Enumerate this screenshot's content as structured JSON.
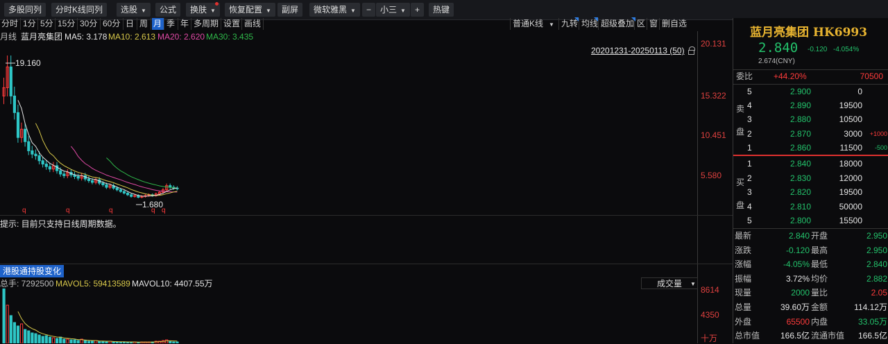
{
  "toolbar": {
    "items": [
      {
        "label": "多股同列",
        "dropdown": false
      },
      {
        "label": "分时K线同列",
        "dropdown": false
      },
      {
        "label": "选股",
        "dropdown": true
      },
      {
        "label": "公式",
        "dropdown": false
      },
      {
        "label": "换肤",
        "dropdown": true
      },
      {
        "label": "恢复配置",
        "dropdown": true
      },
      {
        "label": "副屏",
        "dropdown": false
      },
      {
        "label": "微软雅黑",
        "dropdown": true
      },
      {
        "label": "−",
        "dropdown": false
      },
      {
        "label": "小三",
        "dropdown": true
      },
      {
        "label": "+",
        "dropdown": false
      },
      {
        "label": "热键",
        "dropdown": false
      }
    ]
  },
  "periods": [
    "分时",
    "1分",
    "5分",
    "15分",
    "30分",
    "60分",
    "日",
    "周",
    "月",
    "季",
    "年",
    "多周期",
    "设置",
    "画线"
  ],
  "active_period": "月",
  "right_tools": {
    "kline_type": "普通K线",
    "buttons": [
      "九转",
      "均线",
      "超级叠加",
      "区",
      "窗",
      "删自选"
    ]
  },
  "ma_info": {
    "prefix": "月线",
    "name": "蓝月亮集团",
    "ma5": "MA5: 3.178",
    "ma10": "MA10: 2.613",
    "ma20": "MA20: 2.620",
    "ma30": "MA30: 3.435"
  },
  "date_range": "20201231-20250113 (50)",
  "price_axis": [
    "20.131",
    "15.322",
    "10.451",
    "5.580"
  ],
  "annotations": {
    "high": "19.160",
    "low": "1.680",
    "marker": "q"
  },
  "colors": {
    "up": "#ff3b3b",
    "down": "#2ec6c6",
    "ma5": "#e6e6e6",
    "ma10": "#d8c84a",
    "ma20": "#e04aa5",
    "ma30": "#2fb84a",
    "accent": "#1e62c9"
  },
  "hint": "提示: 目前只支持日线周期数据。",
  "hk_tab": "港股通持股变化",
  "volume": {
    "total": "总手: 7292500",
    "mavol5": "MAVOL5: 59413589",
    "mavol10": "MAVOL10: 4407.55万",
    "indicator": "成交量",
    "axis": [
      "8614",
      "4350",
      "十万"
    ]
  },
  "stock": {
    "name": "蓝月亮集团",
    "code": "HK6993",
    "price": "2.840",
    "change": "-0.120",
    "change_pct": "-4.054%",
    "cny_price": "2.674(CNY)"
  },
  "orderbook": {
    "webi_label": "委比",
    "webi_value": "+44.20%",
    "webi_diff": "70500",
    "sell_label": [
      "卖",
      "盘"
    ],
    "buy_label": [
      "买",
      "盘"
    ],
    "sell": [
      {
        "level": "5",
        "price": "2.900",
        "vol": "0",
        "chg": ""
      },
      {
        "level": "4",
        "price": "2.890",
        "vol": "19500",
        "chg": ""
      },
      {
        "level": "3",
        "price": "2.880",
        "vol": "10500",
        "chg": ""
      },
      {
        "level": "2",
        "price": "2.870",
        "vol": "3000",
        "chg": "+1000"
      },
      {
        "level": "1",
        "price": "2.860",
        "vol": "11500",
        "chg": "-500"
      }
    ],
    "buy": [
      {
        "level": "1",
        "price": "2.840",
        "vol": "18000"
      },
      {
        "level": "2",
        "price": "2.830",
        "vol": "12000"
      },
      {
        "level": "3",
        "price": "2.820",
        "vol": "19500"
      },
      {
        "level": "4",
        "price": "2.810",
        "vol": "50000"
      },
      {
        "level": "5",
        "price": "2.800",
        "vol": "15500"
      }
    ]
  },
  "stats": [
    {
      "l1": "最新",
      "v1": "2.840",
      "c1": "green",
      "l2": "开盘",
      "v2": "2.950",
      "c2": "green"
    },
    {
      "l1": "涨跌",
      "v1": "-0.120",
      "c1": "green",
      "l2": "最高",
      "v2": "2.950",
      "c2": "green"
    },
    {
      "l1": "涨幅",
      "v1": "-4.05%",
      "c1": "green",
      "l2": "最低",
      "v2": "2.840",
      "c2": "green"
    },
    {
      "l1": "振幅",
      "v1": "3.72%",
      "c1": "white",
      "l2": "均价",
      "v2": "2.882",
      "c2": "green"
    },
    {
      "l1": "现量",
      "v1": "2000",
      "c1": "green",
      "l2": "量比",
      "v2": "2.05",
      "c2": "red"
    },
    {
      "l1": "总量",
      "v1": "39.60万",
      "c1": "white",
      "l2": "金额",
      "v2": "114.12万",
      "c2": "white"
    },
    {
      "l1": "外盘",
      "v1": "65500",
      "c1": "red",
      "l2": "内盘",
      "v2": "33.05万",
      "c2": "green"
    },
    {
      "l1": "总市值",
      "v1": "166.5亿",
      "c1": "white",
      "l2": "流通市值",
      "v2": "166.5亿",
      "c2": "white"
    }
  ]
}
